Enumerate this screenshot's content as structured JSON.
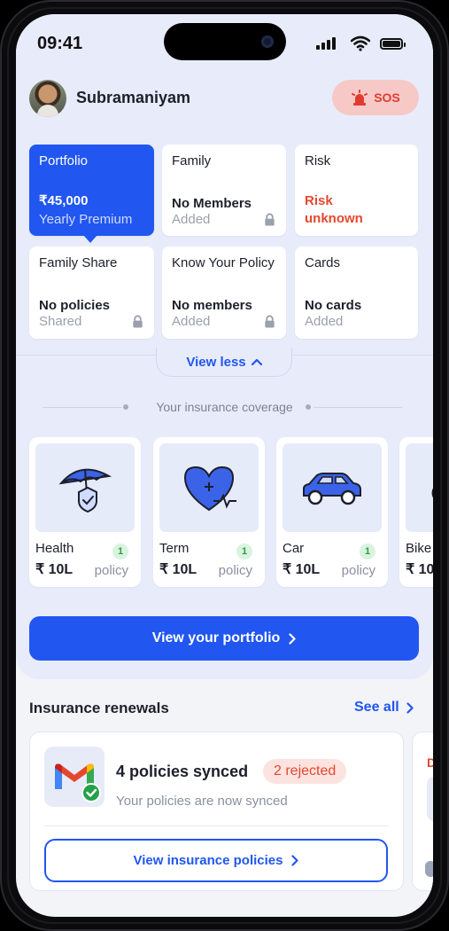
{
  "status_bar": {
    "time": "09:41"
  },
  "header": {
    "username": "Subramaniyam",
    "sos_label": "SOS"
  },
  "summary_cards": [
    {
      "title": "Portfolio",
      "line1": "₹45,000",
      "line2": "Yearly Premium",
      "active": true
    },
    {
      "title": "Family",
      "line1": "No Members",
      "line2": "Added",
      "locked": true
    },
    {
      "title": "Risk",
      "line1": "Risk",
      "line2": "unknown",
      "alert": true
    },
    {
      "title": "Family Share",
      "line1": "No policies",
      "line2": "Shared",
      "locked": true
    },
    {
      "title": "Know Your Policy",
      "line1": "No members",
      "line2": "Added",
      "locked": true
    },
    {
      "title": "Cards",
      "line1": "No cards",
      "line2": "Added"
    }
  ],
  "view_less_label": "View less",
  "coverage_label": "Your insurance coverage",
  "insurance": [
    {
      "name": "Health",
      "amount": "₹ 10L",
      "count": "1",
      "policy_label": "policy",
      "icon": "umbrella-shield-icon"
    },
    {
      "name": "Term",
      "amount": "₹ 10L",
      "count": "1",
      "policy_label": "policy",
      "icon": "heart-pulse-icon"
    },
    {
      "name": "Car",
      "amount": "₹ 10L",
      "count": "1",
      "policy_label": "policy",
      "icon": "car-icon"
    },
    {
      "name": "Bike",
      "amount": "₹ 10",
      "icon": "bike-icon"
    }
  ],
  "portfolio_cta": "View your portfolio",
  "renewals": {
    "title": "Insurance renewals",
    "see_all": "See all",
    "card": {
      "title": "4 policies synced",
      "badge": "2 rejected",
      "subtitle": "Your policies are now synced",
      "button": "View insurance policies"
    },
    "peek_label": "D"
  },
  "colors": {
    "accent": "#2156f0",
    "danger": "#e5472d",
    "background": "#e8ecfa"
  }
}
